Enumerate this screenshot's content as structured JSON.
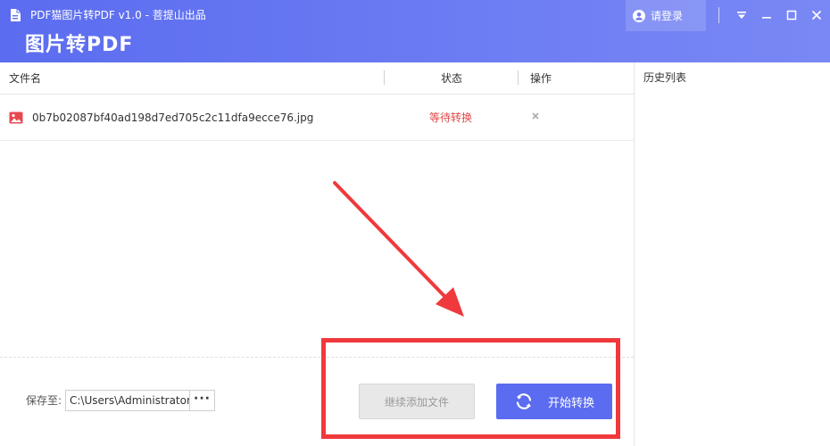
{
  "window": {
    "title": "PDF猫图片转PDF v1.0 - 菩提山出品",
    "heading": "图片转PDF",
    "login_label": "请登录"
  },
  "table": {
    "col_filename": "文件名",
    "col_status": "状态",
    "col_action": "操作",
    "rows": [
      {
        "name": "0b7b02087bf40ad198d7ed705c2c11dfa9ecce76.jpg",
        "status": "等待转换",
        "action_icon": "close-icon"
      }
    ]
  },
  "history": {
    "title": "历史列表"
  },
  "bottom": {
    "save_label": "保存至:",
    "save_path": "C:\\Users\\Administrator",
    "browse_label": "···",
    "add_more_label": "继续添加文件",
    "start_label": "开始转换"
  },
  "colors": {
    "accent": "#5b6cf0",
    "status_waiting": "#e04848",
    "annotation_red": "#f0393c"
  }
}
